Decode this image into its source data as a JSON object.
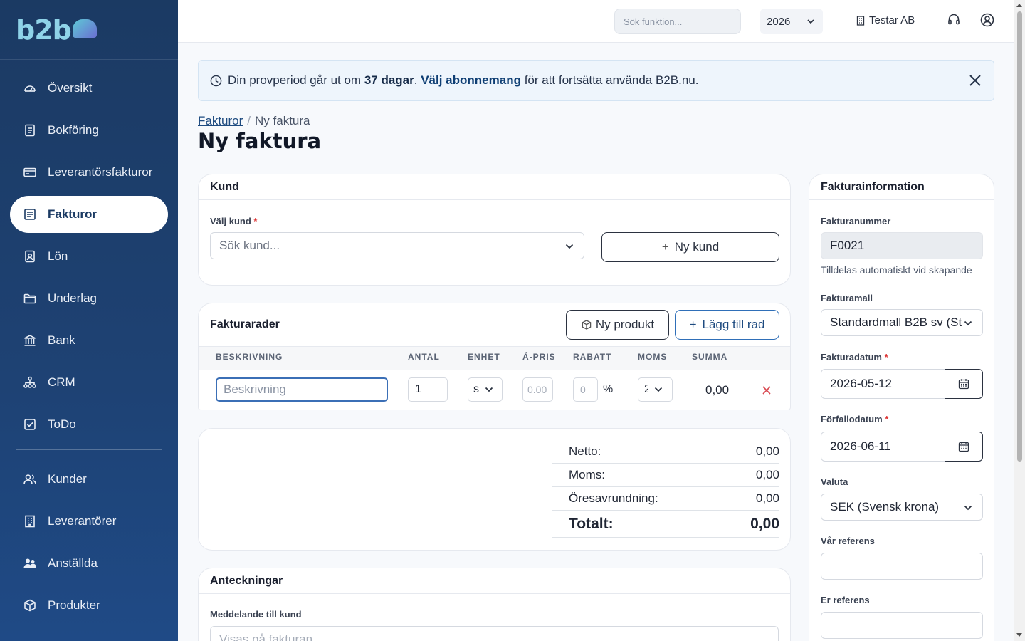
{
  "logo": {
    "text": "b2b"
  },
  "sidebar": {
    "items": [
      {
        "label": "Översikt",
        "icon": "gauge-icon"
      },
      {
        "label": "Bokföring",
        "icon": "ledger-icon"
      },
      {
        "label": "Leverantörsfakturor",
        "icon": "card-icon"
      },
      {
        "label": "Fakturor",
        "icon": "invoice-icon",
        "active": true
      },
      {
        "label": "Lön",
        "icon": "badge-icon"
      },
      {
        "label": "Underlag",
        "icon": "folder-icon"
      },
      {
        "label": "Bank",
        "icon": "bank-icon"
      },
      {
        "label": "CRM",
        "icon": "network-icon"
      },
      {
        "label": "ToDo",
        "icon": "checkbox-icon"
      }
    ],
    "items2": [
      {
        "label": "Kunder",
        "icon": "users-icon"
      },
      {
        "label": "Leverantörer",
        "icon": "building-icon"
      },
      {
        "label": "Anställda",
        "icon": "people-icon"
      },
      {
        "label": "Produkter",
        "icon": "box-icon"
      }
    ]
  },
  "topbar": {
    "search_placeholder": "Sök funktion...",
    "year": "2026",
    "company": "Testar AB"
  },
  "banner": {
    "text1": "Din provperiod går ut om ",
    "days": "37 dagar",
    "text2": ". ",
    "link": "Välj abonnemang",
    "text3": " för att fortsätta använda B2B.nu."
  },
  "breadcrumb": {
    "parent": "Fakturor",
    "current": "Ny faktura"
  },
  "page_title": "Ny faktura",
  "kund": {
    "title": "Kund",
    "select_label": "Välj kund",
    "select_placeholder": "Sök kund...",
    "new_button": "Ny kund"
  },
  "rows": {
    "title": "Fakturarader",
    "new_product": "Ny produkt",
    "add_row": "Lägg till rad",
    "headers": {
      "desc": "BESKRIVNING",
      "qty": "ANTAL",
      "unit": "ENHET",
      "price": "Á-PRIS",
      "discount": "RABATT",
      "vat": "MOMS",
      "sum": "SUMMA"
    },
    "row": {
      "desc_placeholder": "Beskrivning",
      "qty": "1",
      "unit": "s",
      "price_placeholder": "0.00",
      "discount_placeholder": "0",
      "pct": "%",
      "vat": "2",
      "sum": "0,00"
    }
  },
  "totals": {
    "netto_label": "Netto:",
    "netto": "0,00",
    "moms_label": "Moms:",
    "moms": "0,00",
    "rounding_label": "Öresavrundning:",
    "rounding": "0,00",
    "total_label": "Totalt:",
    "total": "0,00"
  },
  "notes": {
    "title": "Anteckningar",
    "message_label": "Meddelande till kund",
    "message_placeholder": "Visas på fakturan"
  },
  "invoice_info": {
    "title": "Fakturainformation",
    "number_label": "Fakturanummer",
    "number": "F0021",
    "number_hint": "Tilldelas automatiskt vid skapande",
    "template_label": "Fakturamall",
    "template": "Standardmall B2B sv (St",
    "date_label": "Fakturadatum",
    "date": "2026-05-12",
    "due_label": "Förfallodatum",
    "due": "2026-06-11",
    "currency_label": "Valuta",
    "currency": "SEK (Svensk krona)",
    "our_ref_label": "Vår referens",
    "your_ref_label": "Er referens"
  }
}
